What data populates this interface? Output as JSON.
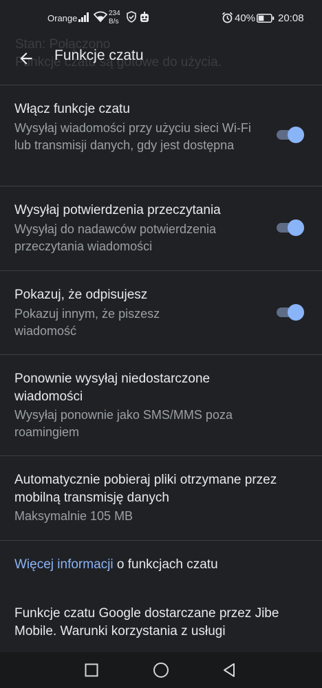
{
  "status_bar": {
    "carrier": "Orange",
    "net_speed_value": "234",
    "net_speed_unit": "B/s",
    "battery_percent": "40%",
    "time": "20:08",
    "icons": [
      "signal-icon",
      "wifi-icon",
      "shield-icon",
      "robot-icon",
      "alarm-icon",
      "battery-icon"
    ]
  },
  "ghost_text": {
    "line1": "Stan: Połączono",
    "line2": "Funkcje czatu są gotowe do użycia."
  },
  "header": {
    "title": "Funkcje czatu",
    "back_icon": "arrow-back-icon"
  },
  "settings": [
    {
      "title": "Włącz funkcje czatu",
      "subtitle": "Wysyłaj wiadomości przy użyciu sieci Wi-Fi lub transmisji danych, gdy jest dostępna",
      "toggle_on": true
    },
    {
      "title": "Wysyłaj potwierdzenia przeczytania",
      "subtitle": "Wysyłaj do nadawców potwierdzenia przeczytania wiadomości",
      "toggle_on": true
    },
    {
      "title": "Pokazuj, że odpisujesz",
      "subtitle": "Pokazuj innym, że piszesz wiadomość",
      "toggle_on": true
    },
    {
      "title": "Ponownie wysyłaj niedostarczone wiadomości",
      "subtitle": "Wysyłaj ponownie jako SMS/MMS poza roamingiem"
    },
    {
      "title": "Automatycznie pobieraj pliki otrzymane przez mobilną transmisję danych",
      "subtitle": "Maksymalnie 105 MB"
    }
  ],
  "info": {
    "link": "Więcej informacji",
    "rest": " o funkcjach czatu"
  },
  "footer": {
    "text": "Funkcje czatu Google dostarczane przez Jibe Mobile. Warunki korzystania z usługi"
  },
  "colors": {
    "background": "#202124",
    "accent": "#8ab4f8",
    "toggle_track": "#5e6c87",
    "secondary_text": "#9aa0a6"
  },
  "nav_bar": {
    "icons": [
      "recents-square-icon",
      "home-circle-icon",
      "back-triangle-icon"
    ]
  }
}
